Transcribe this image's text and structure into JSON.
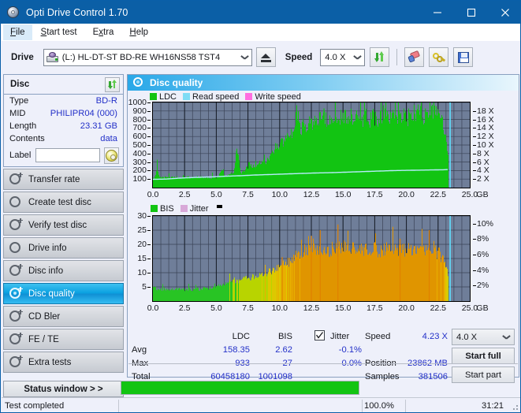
{
  "window": {
    "title": "Opti Drive Control 1.70",
    "icon": "disc-icon",
    "minimize": "minimize-icon",
    "maximize": "maximize-icon",
    "close": "close-icon"
  },
  "menu": {
    "items": [
      {
        "label": "File",
        "active": true
      },
      {
        "label": "Start test",
        "active": false
      },
      {
        "label": "Extra",
        "active": false
      },
      {
        "label": "Help",
        "active": false
      }
    ]
  },
  "toolbar": {
    "drive_label": "Drive",
    "drive_value": "(L:)  HL-DT-ST BD-RE  WH16NS58 TST4",
    "eject_title": "eject-icon",
    "speed_label": "Speed",
    "speed_value": "4.0 X",
    "refresh_title": "refresh-icon",
    "erase_title": "eraser-icon",
    "key_title": "key-icon",
    "save_title": "save-icon"
  },
  "disc_panel": {
    "header": "Disc",
    "refresh_title": "refresh-icon",
    "rows": [
      {
        "key": "Type",
        "value": "BD-R"
      },
      {
        "key": "MID",
        "value": "PHILIPR04 (000)"
      },
      {
        "key": "Length",
        "value": "23.31 GB"
      },
      {
        "key": "Contents",
        "value": "data"
      }
    ],
    "label_key": "Label",
    "label_value": "",
    "label_placeholder": "",
    "label_button_title": "cd-icon"
  },
  "nav": {
    "items": [
      {
        "label": "Transfer rate",
        "selected": false
      },
      {
        "label": "Create test disc",
        "selected": false
      },
      {
        "label": "Verify test disc",
        "selected": false
      },
      {
        "label": "Drive info",
        "selected": false
      },
      {
        "label": "Disc info",
        "selected": false
      },
      {
        "label": "Disc quality",
        "selected": true
      },
      {
        "label": "CD Bler",
        "selected": false
      },
      {
        "label": "FE / TE",
        "selected": false
      },
      {
        "label": "Extra tests",
        "selected": false
      }
    ],
    "status_window": "Status window > >"
  },
  "main": {
    "title": "Disc quality",
    "icon": "disc-quality-icon"
  },
  "stats": {
    "col_ldc": "LDC",
    "col_bis": "BIS",
    "rows": [
      {
        "label": "Avg",
        "ldc": "158.35",
        "bis": "2.62",
        "jitter": "-0.1%"
      },
      {
        "label": "Max",
        "ldc": "933",
        "bis": "27",
        "jitter": "0.0%"
      },
      {
        "label": "Total",
        "ldc": "60458180",
        "bis": "1001098",
        "jitter": ""
      }
    ],
    "jitter_label": "Jitter",
    "jitter_checked": true,
    "speed_label": "Speed",
    "speed_value": "4.23 X",
    "position_label": "Position",
    "position_value": "23862 MB",
    "samples_label": "Samples",
    "samples_value": "381506",
    "speed_select": "4.0 X",
    "start_full": "Start full",
    "start_part": "Start part"
  },
  "statusbar": {
    "text": "Test completed",
    "percent": "100.0%",
    "progress": 100,
    "time": "31:21"
  },
  "colors": {
    "accent": "#0b5fa6",
    "plot_bg": "#6f7e99",
    "ldc_green": "#12c412",
    "read_speed": "#7fdcf5",
    "write_speed": "#ff6ee0",
    "bis_green": "#12c412",
    "jitter_pink": "#d8a8d8",
    "value_blue": "#2330c8",
    "progress_green": "#12c412",
    "cursor_cyan": "#5fe0ff"
  },
  "chart_data": [
    {
      "type": "area",
      "id": "ldc-chart",
      "title": "",
      "xlabel": "GB",
      "ylabel": "LDC",
      "legend": [
        {
          "label": "LDC",
          "color": "#12c412"
        },
        {
          "label": "Read speed",
          "color": "#7fdcf5"
        },
        {
          "label": "Write speed",
          "color": "#ff6ee0"
        }
      ],
      "legend_position": "top-left",
      "grid": true,
      "xlim": [
        0,
        25
      ],
      "xticks": [
        "0.0",
        "2.5",
        "5.0",
        "7.5",
        "10.0",
        "12.5",
        "15.0",
        "17.5",
        "20.0",
        "22.5",
        "25.0"
      ],
      "ylim": [
        0,
        1000
      ],
      "yticks": [
        100,
        200,
        300,
        400,
        500,
        600,
        700,
        800,
        900,
        1000
      ],
      "y2lim": [
        0,
        20
      ],
      "y2ticks": [
        "2 X",
        "4 X",
        "6 X",
        "8 X",
        "10 X",
        "12 X",
        "14 X",
        "16 X",
        "18 X"
      ],
      "cursor_x": 23.45,
      "data_end_x": 23.35,
      "series": [
        {
          "name": "LDC",
          "color": "#12c412",
          "x": [
            0.1,
            0.3,
            0.5,
            0.7,
            0.9,
            1.2,
            1.5,
            1.8,
            2.1,
            2.4,
            2.7,
            3.0,
            3.3,
            3.6,
            3.9,
            4.2,
            4.5,
            4.8,
            5.1,
            5.4,
            5.7,
            6.0,
            6.3,
            6.6,
            6.9,
            7.2,
            7.5,
            7.8,
            8.1,
            8.4,
            8.7,
            9.0,
            9.3,
            9.6,
            9.9,
            10.2,
            10.5,
            10.8,
            11.1,
            11.4,
            11.7,
            12.0,
            12.3,
            12.6,
            12.9,
            13.2,
            13.5,
            13.8,
            14.1,
            14.4,
            14.7,
            15.0,
            15.3,
            15.6,
            15.9,
            16.2,
            16.5,
            16.8,
            17.1,
            17.4,
            17.7,
            18.0,
            18.3,
            18.6,
            18.9,
            19.2,
            19.5,
            19.8,
            20.1,
            20.4,
            20.7,
            21.0,
            21.3,
            21.6,
            21.9,
            22.2,
            22.5,
            22.8,
            23.1,
            23.3
          ],
          "y": [
            110,
            230,
            120,
            115,
            118,
            120,
            112,
            118,
            115,
            120,
            118,
            115,
            122,
            118,
            120,
            118,
            116,
            120,
            125,
            190,
            135,
            160,
            150,
            430,
            180,
            200,
            260,
            255,
            270,
            290,
            320,
            300,
            420,
            450,
            480,
            520,
            560,
            620,
            655,
            690,
            700,
            720,
            740,
            760,
            780,
            800,
            790,
            770,
            830,
            790,
            810,
            800,
            830,
            805,
            790,
            770,
            800,
            820,
            790,
            830,
            800,
            850,
            820,
            800,
            830,
            805,
            820,
            840,
            800,
            860,
            880,
            820,
            800,
            830,
            900,
            870,
            830,
            760,
            650,
            280
          ],
          "peaks": [
            {
              "x": 6.6,
              "y": 430
            },
            {
              "x": 13.5,
              "y": 930
            },
            {
              "x": 15.0,
              "y": 880
            },
            {
              "x": 18.0,
              "y": 900
            },
            {
              "x": 21.5,
              "y": 930
            },
            {
              "x": 22.5,
              "y": 920
            }
          ]
        },
        {
          "name": "Read speed",
          "color": "#b6ecfb",
          "x": [
            0.0,
            1.0,
            2.0,
            3.0,
            4.0,
            5.0,
            6.0,
            7.0,
            8.0,
            9.0,
            10.0,
            11.0,
            12.0,
            13.0,
            14.0,
            15.0,
            16.0,
            17.0,
            18.0,
            19.0,
            20.0,
            21.0,
            22.0,
            23.0,
            23.35
          ],
          "y_speed_x": [
            1.95,
            2.0,
            2.2,
            2.35,
            2.45,
            2.55,
            2.7,
            2.8,
            2.95,
            3.05,
            3.15,
            3.25,
            3.35,
            3.45,
            3.5,
            3.6,
            3.7,
            3.8,
            3.9,
            4.0,
            4.05,
            4.1,
            4.15,
            4.2,
            4.25
          ]
        }
      ]
    },
    {
      "type": "area",
      "id": "bis-chart",
      "title": "",
      "xlabel": "GB",
      "ylabel": "BIS",
      "legend": [
        {
          "label": "BIS",
          "color": "#12c412"
        },
        {
          "label": "Jitter",
          "color": "#d8a8d8"
        }
      ],
      "legend_position": "top-left",
      "grid": true,
      "xlim": [
        0,
        25
      ],
      "xticks": [
        "0.0",
        "2.5",
        "5.0",
        "7.5",
        "10.0",
        "12.5",
        "15.0",
        "17.5",
        "20.0",
        "22.5",
        "25.0"
      ],
      "ylim": [
        0,
        30
      ],
      "yticks": [
        5,
        10,
        15,
        20,
        25,
        30
      ],
      "y2lim": [
        0,
        11
      ],
      "y2ticks": [
        "2%",
        "4%",
        "6%",
        "8%",
        "10%"
      ],
      "cursor_x": 23.45,
      "data_end_x": 23.35,
      "series": [
        {
          "name": "BIS",
          "color": "#12c412",
          "color_high": "#e8b800",
          "x": [
            0.1,
            0.4,
            0.7,
            1.0,
            1.3,
            1.6,
            1.9,
            2.2,
            2.5,
            2.8,
            3.1,
            3.4,
            3.7,
            4.0,
            4.3,
            4.6,
            4.9,
            5.2,
            5.5,
            5.8,
            6.1,
            6.4,
            6.7,
            7.0,
            7.3,
            7.6,
            7.9,
            8.2,
            8.5,
            8.8,
            9.1,
            9.4,
            9.7,
            10.0,
            10.3,
            10.6,
            10.9,
            11.2,
            11.5,
            11.8,
            12.1,
            12.4,
            12.7,
            13.0,
            13.3,
            13.6,
            13.9,
            14.2,
            14.5,
            14.8,
            15.1,
            15.4,
            15.7,
            16.0,
            16.3,
            16.6,
            16.9,
            17.2,
            17.5,
            17.8,
            18.1,
            18.4,
            18.7,
            19.0,
            19.3,
            19.6,
            19.9,
            20.2,
            20.5,
            20.8,
            21.1,
            21.4,
            21.7,
            22.0,
            22.3,
            22.6,
            22.9,
            23.2,
            23.35
          ],
          "y": [
            4.5,
            4.2,
            4.0,
            3.8,
            4.0,
            3.9,
            4.2,
            4.0,
            3.8,
            4.1,
            4.0,
            4.2,
            4.0,
            4.5,
            4.3,
            4.8,
            5.0,
            5.2,
            5.5,
            6.0,
            6.5,
            7.0,
            6.8,
            7.5,
            8.0,
            7.8,
            8.5,
            9.0,
            8.8,
            9.5,
            10.0,
            10.5,
            11.0,
            12.0,
            13.0,
            13.5,
            14.0,
            15.5,
            16.5,
            17.0,
            17.5,
            17.0,
            18.0,
            17.5,
            17.0,
            18.5,
            17.5,
            18.0,
            17.5,
            18.5,
            19.0,
            17.5,
            18.0,
            17.5,
            18.5,
            17.0,
            18.0,
            17.5,
            18.0,
            17.0,
            17.5,
            18.0,
            17.5,
            18.5,
            17.0,
            18.0,
            17.5,
            18.0,
            17.0,
            18.5,
            18.0,
            17.5,
            18.0,
            17.5,
            17.0,
            16.0,
            14.0,
            10.0,
            5.0
          ],
          "peaks": [
            {
              "x": 10.2,
              "y": 15.5
            },
            {
              "x": 13.2,
              "y": 25.0
            },
            {
              "x": 14.6,
              "y": 27.0
            },
            {
              "x": 12.5,
              "y": 23.0
            },
            {
              "x": 21.8,
              "y": 25.0
            },
            {
              "x": 19.5,
              "y": 22.0
            }
          ]
        }
      ]
    }
  ]
}
